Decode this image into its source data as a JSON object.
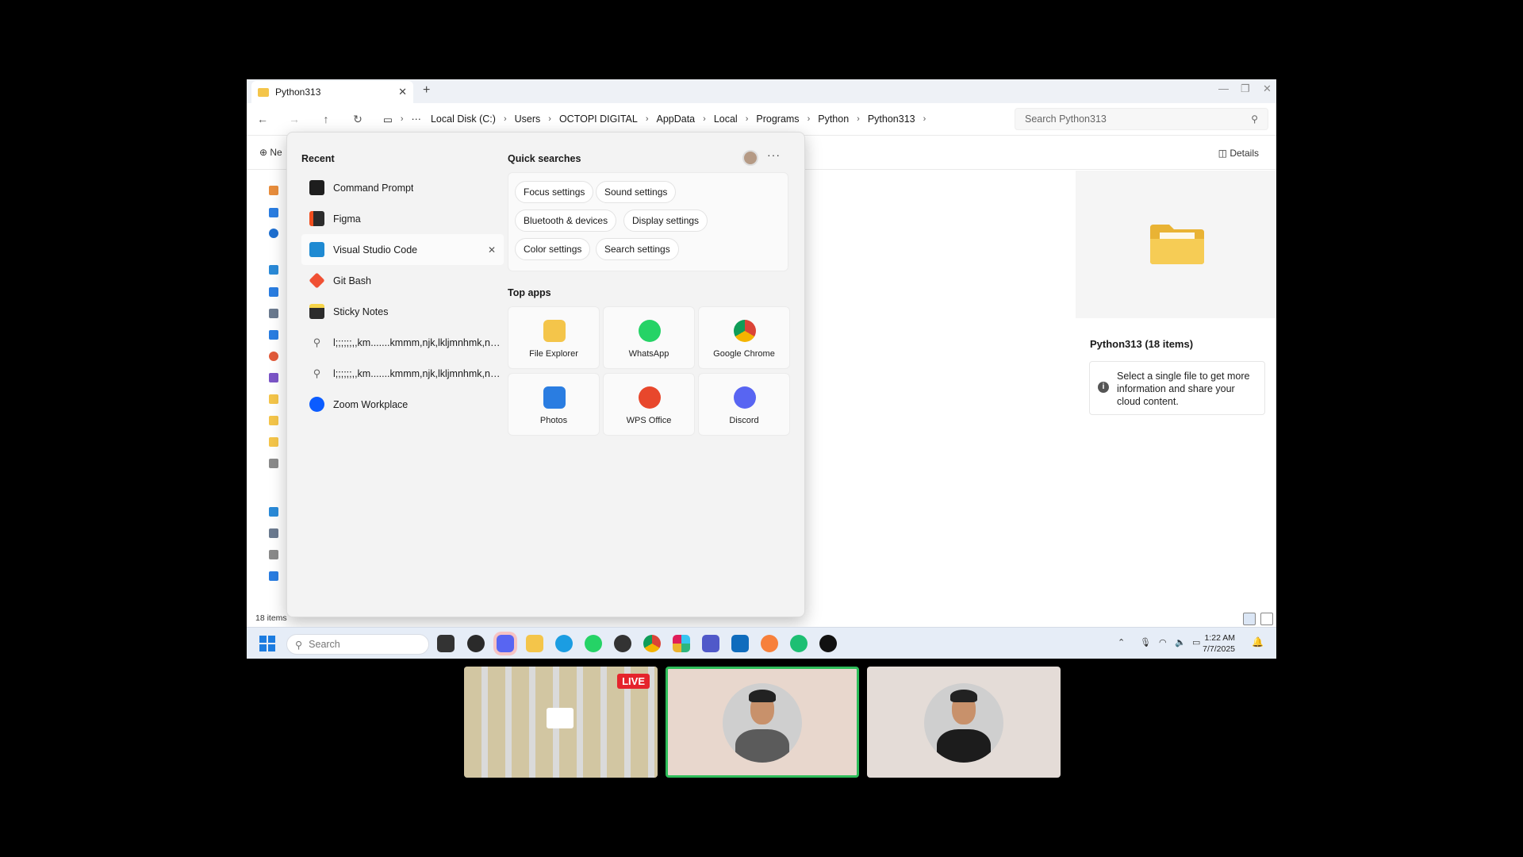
{
  "window": {
    "tab_title": "Python313",
    "tab_close": "✕",
    "new_tab": "+",
    "minimize": "—",
    "maximize": "❐",
    "close": "✕"
  },
  "address": {
    "breadcrumbs": [
      "Local Disk (C:)",
      "Users",
      "OCTOPI DIGITAL",
      "AppData",
      "Local",
      "Programs",
      "Python",
      "Python313"
    ],
    "ellipsis": "···",
    "search_placeholder": "Search Python313"
  },
  "commandbar": {
    "new_label": "⊕ Ne",
    "details_label": "Details"
  },
  "status": {
    "item_count": "18 items"
  },
  "details_pane": {
    "title": "Python313 (18 items)",
    "info_text": "Select a single file to get more information and share your cloud content."
  },
  "start_menu": {
    "recent_heading": "Recent",
    "quick_heading": "Quick searches",
    "top_apps_heading": "Top apps",
    "more": "···",
    "recent": [
      {
        "label": "Command Prompt",
        "icon": "command-prompt-icon",
        "color": "#1e1e1e"
      },
      {
        "label": "Figma",
        "icon": "figma-icon",
        "color": "#2c2c2c"
      },
      {
        "label": "Visual Studio Code",
        "icon": "vscode-icon",
        "color": "#1f8ad2"
      },
      {
        "label": "Git Bash",
        "icon": "git-bash-icon",
        "color": "#f05033"
      },
      {
        "label": "Sticky Notes",
        "icon": "sticky-notes-icon",
        "color": "#2b2b2b"
      },
      {
        "label": "l;;;;;;,,km.......kmmm,njk,lkljmnhmk,nhmk...",
        "icon": "search-icon",
        "color": "#666666"
      },
      {
        "label": "l;;;;;;,,km.......kmmm,njk,lkljmnhmk,nhmk...",
        "icon": "search-icon",
        "color": "#666666"
      },
      {
        "label": "Zoom Workplace",
        "icon": "zoom-icon",
        "color": "#0b5cff"
      }
    ],
    "recent_remove": "✕",
    "quick_searches": [
      "Focus settings",
      "Sound settings",
      "Bluetooth & devices",
      "Display settings",
      "Color settings",
      "Search settings"
    ],
    "top_apps": [
      {
        "label": "File Explorer",
        "icon": "file-explorer-icon",
        "color": "#f4c54a"
      },
      {
        "label": "WhatsApp",
        "icon": "whatsapp-icon",
        "color": "#25d366"
      },
      {
        "label": "Google Chrome",
        "icon": "chrome-icon",
        "color": "#db4437"
      },
      {
        "label": "Photos",
        "icon": "photos-icon",
        "color": "#2a7de1"
      },
      {
        "label": "WPS Office",
        "icon": "wps-office-icon",
        "color": "#e8472c"
      },
      {
        "label": "Discord",
        "icon": "discord-icon",
        "color": "#5865f2"
      }
    ]
  },
  "taskbar": {
    "search_placeholder": "Search",
    "time": "1:22 AM",
    "date": "7/7/2025",
    "apps": [
      {
        "icon": "task-view-icon",
        "color": "#333333"
      },
      {
        "icon": "obs-icon",
        "color": "#2a2a2a"
      },
      {
        "icon": "discord-icon",
        "color": "#5865f2"
      },
      {
        "icon": "file-explorer-icon",
        "color": "#f4c54a"
      },
      {
        "icon": "edge-icon",
        "color": "#1b9de2"
      },
      {
        "icon": "whatsapp-icon",
        "color": "#25d366"
      },
      {
        "icon": "chatgpt-icon",
        "color": "#333333"
      },
      {
        "icon": "chrome-icon",
        "color": "#db4437"
      },
      {
        "icon": "slack-icon",
        "color": "#4a154b"
      },
      {
        "icon": "teams-icon",
        "color": "#5059c9"
      },
      {
        "icon": "outlook-icon",
        "color": "#0f6cbd"
      },
      {
        "icon": "swift-icon",
        "color": "#f7803b"
      },
      {
        "icon": "fiverr-icon",
        "color": "#1dbf73"
      },
      {
        "icon": "upwork-icon",
        "color": "#111111"
      }
    ]
  },
  "meeting": {
    "live_badge": "LIVE"
  }
}
